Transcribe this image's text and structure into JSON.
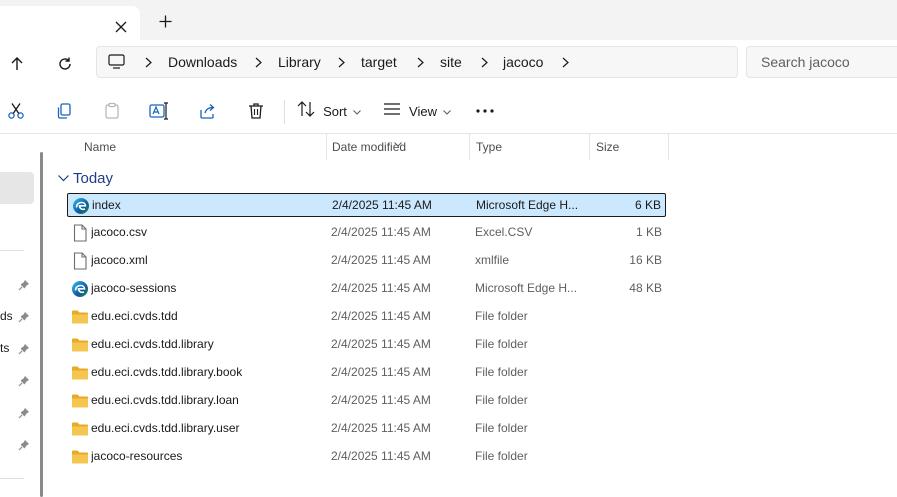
{
  "tabs": {
    "close_icon": "close-icon",
    "new_tab_icon": "plus-icon"
  },
  "navigation": {
    "up_icon": "arrow-up-icon",
    "refresh_icon": "refresh-icon"
  },
  "address": {
    "root_icon": "computer-icon",
    "breadcrumbs": [
      "Downloads",
      "Library",
      "target",
      "site",
      "jacoco"
    ]
  },
  "search": {
    "placeholder": "Search jacoco"
  },
  "toolbar": {
    "cut_icon": "scissors-icon",
    "copy_icon": "copy-icon",
    "paste_icon": "clipboard-icon",
    "rename_icon": "rename-icon",
    "share_icon": "share-icon",
    "delete_icon": "trash-icon",
    "sort_label": "Sort",
    "view_label": "View",
    "more_icon": "more-icon"
  },
  "nav_pane": {
    "fragments": [
      "ds",
      "ts"
    ]
  },
  "columns": {
    "name": "Name",
    "date": "Date modified",
    "type": "Type",
    "size": "Size"
  },
  "group": {
    "label": "Today"
  },
  "files": [
    {
      "name": "index",
      "date": "2/4/2025 11:45 AM",
      "type": "Microsoft Edge H...",
      "size": "6 KB",
      "icon": "edge-icon",
      "selected": true
    },
    {
      "name": "jacoco.csv",
      "date": "2/4/2025 11:45 AM",
      "type": "Excel.CSV",
      "size": "1 KB",
      "icon": "file-icon",
      "selected": false
    },
    {
      "name": "jacoco.xml",
      "date": "2/4/2025 11:45 AM",
      "type": "xmlfile",
      "size": "16 KB",
      "icon": "file-icon",
      "selected": false
    },
    {
      "name": "jacoco-sessions",
      "date": "2/4/2025 11:45 AM",
      "type": "Microsoft Edge H...",
      "size": "48 KB",
      "icon": "edge-icon",
      "selected": false
    },
    {
      "name": "edu.eci.cvds.tdd",
      "date": "2/4/2025 11:45 AM",
      "type": "File folder",
      "size": "",
      "icon": "folder-icon",
      "selected": false
    },
    {
      "name": "edu.eci.cvds.tdd.library",
      "date": "2/4/2025 11:45 AM",
      "type": "File folder",
      "size": "",
      "icon": "folder-icon",
      "selected": false
    },
    {
      "name": "edu.eci.cvds.tdd.library.book",
      "date": "2/4/2025 11:45 AM",
      "type": "File folder",
      "size": "",
      "icon": "folder-icon",
      "selected": false
    },
    {
      "name": "edu.eci.cvds.tdd.library.loan",
      "date": "2/4/2025 11:45 AM",
      "type": "File folder",
      "size": "",
      "icon": "folder-icon",
      "selected": false
    },
    {
      "name": "edu.eci.cvds.tdd.library.user",
      "date": "2/4/2025 11:45 AM",
      "type": "File folder",
      "size": "",
      "icon": "folder-icon",
      "selected": false
    },
    {
      "name": "jacoco-resources",
      "date": "2/4/2025 11:45 AM",
      "type": "File folder",
      "size": "",
      "icon": "folder-icon",
      "selected": false
    }
  ],
  "colors": {
    "selection": "#cce8ff",
    "group_header": "#1f3c88",
    "folder": "#f5c64f"
  }
}
